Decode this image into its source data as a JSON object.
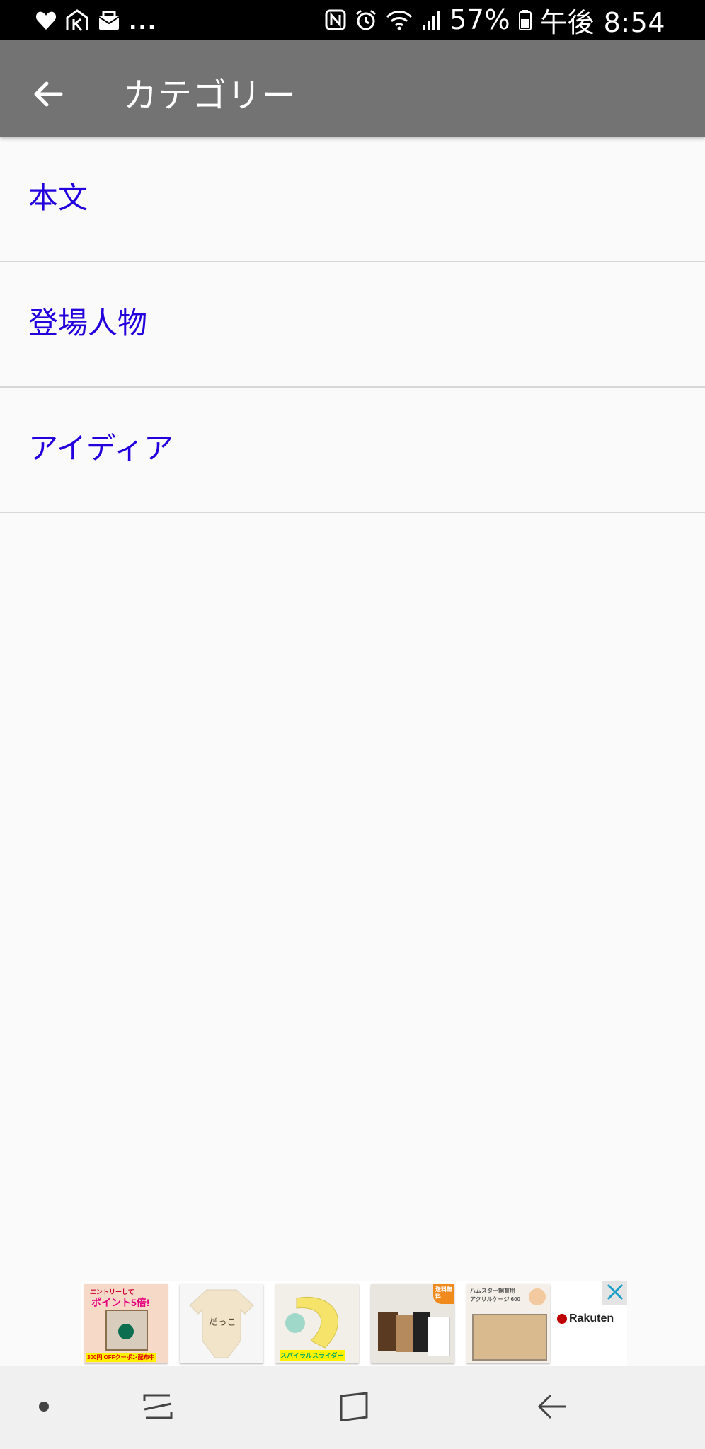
{
  "status_bar": {
    "battery": "57%",
    "time": "午後 8:54",
    "overflow": "...",
    "left_icons": [
      "heart-icon",
      "app-icon",
      "mail-icon"
    ],
    "right_icons": [
      "nfc-icon",
      "alarm-icon",
      "wifi-icon",
      "signal-icon",
      "battery-icon"
    ]
  },
  "app_bar": {
    "title": "カテゴリー",
    "back_icon": "arrow-left-icon",
    "background": "#737373"
  },
  "categories": [
    {
      "label": "本文"
    },
    {
      "label": "登場人物"
    },
    {
      "label": "アイディア"
    }
  ],
  "link_color": "#2200dd",
  "ad": {
    "brand": "Rakuten",
    "close_icon": "close-icon",
    "thumbs": [
      {
        "text_top": "エントリーして",
        "text_mid": "ポイント5倍!",
        "text_bottom": "300円 OFFクーポン配布中"
      },
      {
        "text_top": "",
        "text_mid": "",
        "text_bottom": ""
      },
      {
        "text_top": "",
        "text_mid": "",
        "text_bottom": "スパイラルスライダー"
      },
      {
        "text_top": "送料無料",
        "text_mid": "",
        "text_bottom": ""
      },
      {
        "text_top": "ハムスター飼育用",
        "text_mid": "アクリルケージ 600",
        "text_bottom": ""
      }
    ]
  },
  "nav_bar": {
    "buttons": [
      "dot-icon",
      "recents-icon",
      "home-icon",
      "back-icon"
    ]
  }
}
